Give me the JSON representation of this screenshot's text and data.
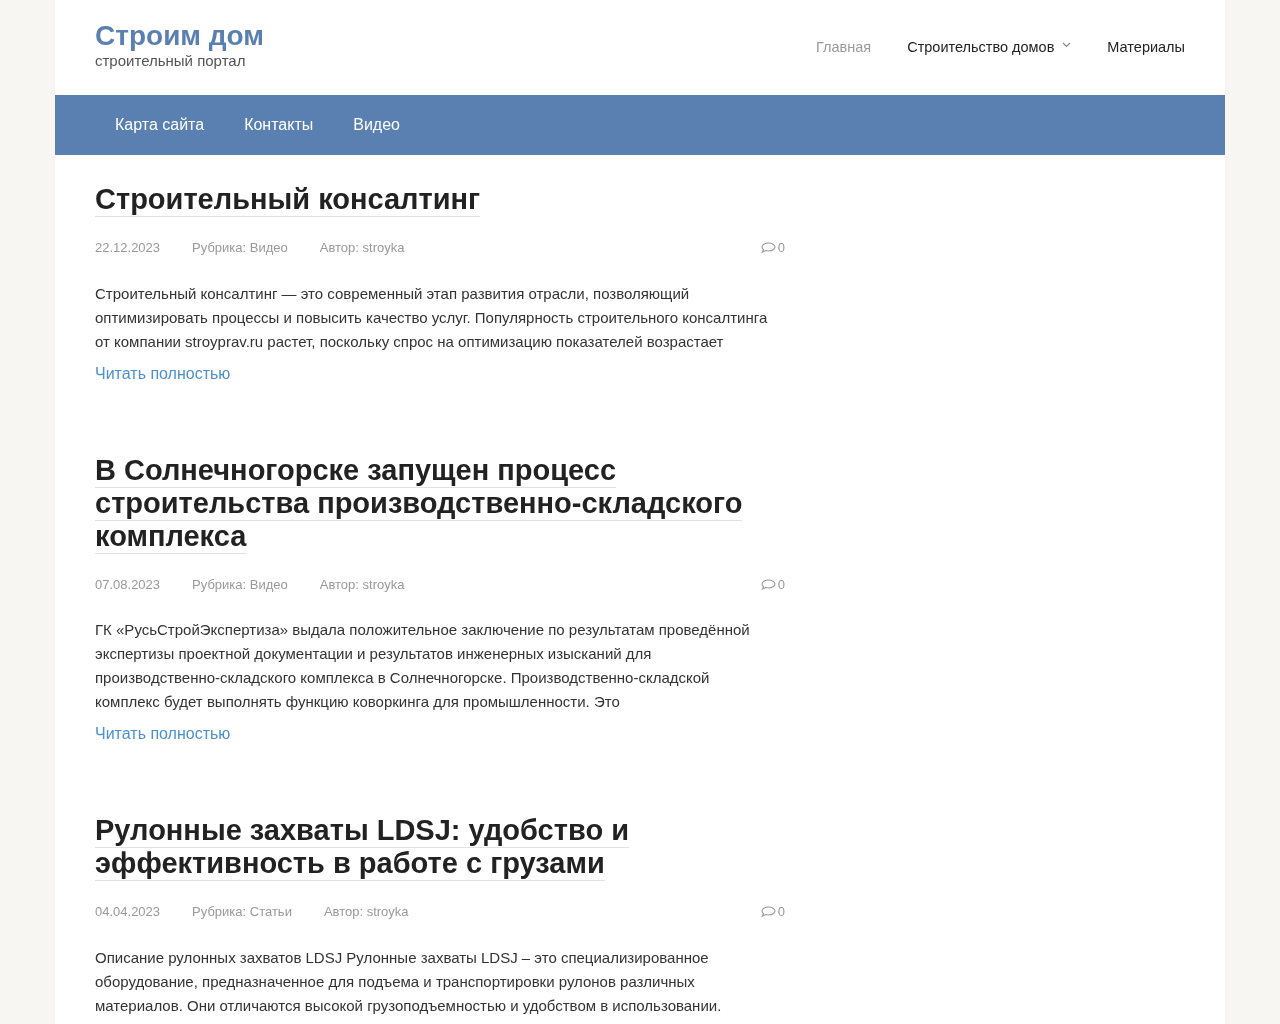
{
  "site": {
    "title": "Строим дом",
    "tagline": "строительный портал"
  },
  "top_menu": [
    {
      "label": "Главная",
      "selected": true,
      "has_submenu": false
    },
    {
      "label": "Строительство домов",
      "selected": false,
      "has_submenu": true
    },
    {
      "label": "Материалы",
      "selected": false,
      "has_submenu": false
    }
  ],
  "bar_menu": [
    "Карта сайта",
    "Контакты",
    "Видео"
  ],
  "articles": [
    {
      "title": "Строительный консалтинг",
      "date": "22.12.2023",
      "category": "Рубрика: Видео",
      "author": "Автор: stroyka",
      "comments": "0",
      "excerpt": "Строительный консалтинг — это современный этап развития отрасли, позволяющий оптимизировать процессы и повысить качество услуг. Популярность строительного консалтинга от компании stroyprav.ru растет, поскольку спрос на оптимизацию показателей возрастает",
      "read_more": "Читать полностью"
    },
    {
      "title": "В Солнечногорске запущен процесс строительства производственно-складского комплекса",
      "date": "07.08.2023",
      "category": "Рубрика: Видео",
      "author": "Автор: stroyka",
      "comments": "0",
      "excerpt": "ГК «РусьСтройЭкспертиза» выдала положительное заключение по результатам проведённой экспертизы проектной документации и результатов инженерных изысканий для производственно-складского комплекса в Солнечногорске. Производственно-складской комплекс будет выполнять функцию коворкинга для промышленности. Это",
      "read_more": "Читать полностью"
    },
    {
      "title": "Рулонные захваты LDSJ: удобство и эффективность в работе с грузами",
      "date": "04.04.2023",
      "category": "Рубрика: Статьи",
      "author": "Автор: stroyka",
      "comments": "0",
      "excerpt": "Описание рулонных захватов LDSJ Рулонные захваты LDSJ – это специализированное оборудование, предназначенное для подъема и транспортировки рулонов различных материалов. Они отличаются высокой грузоподъемностью и удобством в использовании."
    }
  ]
}
